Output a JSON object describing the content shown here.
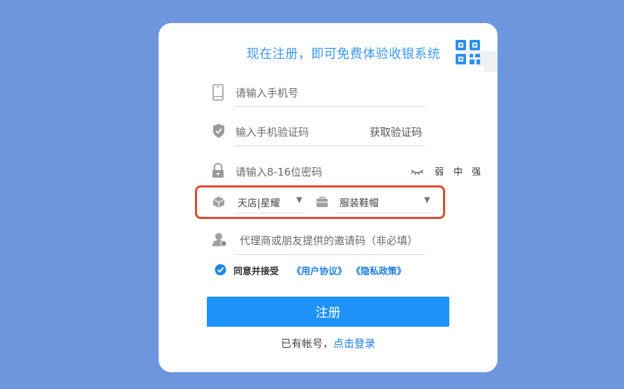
{
  "card": {
    "title": "现在注册，即可免费体验收银系统"
  },
  "form": {
    "phone": {
      "placeholder": "请输入手机号",
      "icon": "phone-icon"
    },
    "code": {
      "placeholder": "输入手机验证码",
      "icon": "shield-icon",
      "get_code_label": "获取验证码"
    },
    "password": {
      "placeholder": "请输入8-16位密码",
      "icon": "lock-icon",
      "strength": {
        "weak": "弱",
        "medium": "中",
        "strong": "强"
      }
    },
    "store_select": {
      "value": "天店|星耀",
      "icon": "cube-icon"
    },
    "industry_select": {
      "value": "服装鞋帽",
      "icon": "briefcase-icon"
    },
    "invite": {
      "placeholder": "代理商或朋友提供的邀请码（非必填）",
      "icon": "user-icon"
    }
  },
  "agreement": {
    "label": "同意并接受",
    "user_agreement": "《用户协议》",
    "privacy_policy": "《隐私政策》",
    "checked": true
  },
  "register_button": "注册",
  "login": {
    "prefix": "已有帐号，",
    "link": "点击登录"
  },
  "colors": {
    "background": "#6d96df",
    "accent": "#1e93f9",
    "title": "#3e98f0",
    "highlight_border": "#e0482f"
  }
}
